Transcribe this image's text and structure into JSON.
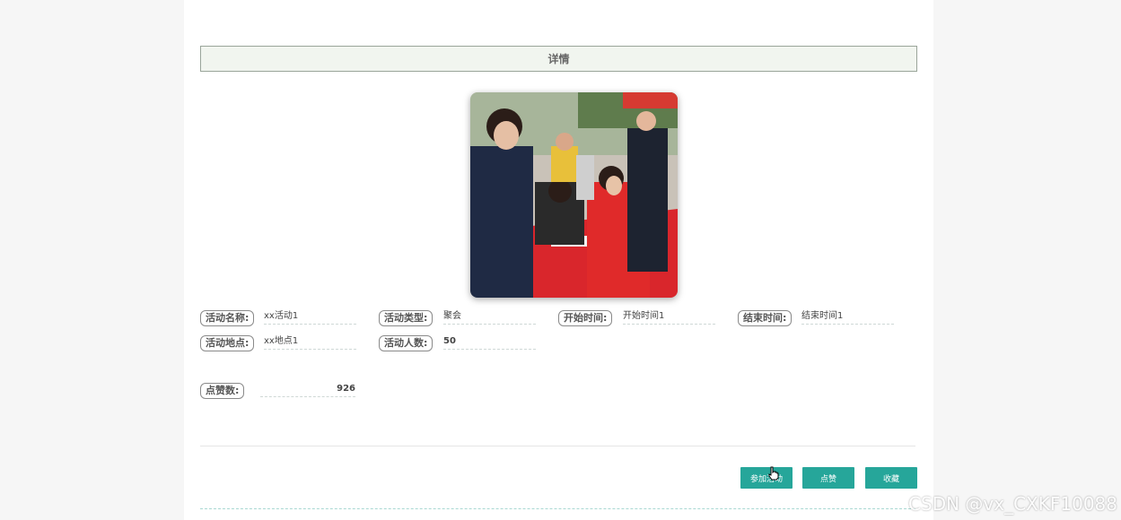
{
  "header": {
    "title": "详情"
  },
  "photo": {
    "alt": "活动图片"
  },
  "fields": [
    {
      "label": "活动名称:",
      "value": "xx活动1"
    },
    {
      "label": "活动类型:",
      "value": "聚会"
    },
    {
      "label": "开始时间:",
      "value": "开始时间1"
    },
    {
      "label": "结束时间:",
      "value": "结束时间1"
    },
    {
      "label": "活动地点:",
      "value": "xx地点1"
    },
    {
      "label": "活动人数:",
      "value": "50"
    }
  ],
  "likes": {
    "label": "点赞数:",
    "value": "926"
  },
  "actions": {
    "join_label": "参加活动",
    "like_label": "点赞",
    "favorite_label": "收藏"
  },
  "watermark": "CSDN @vx_CXKF10088",
  "colors": {
    "accent": "#26a69a",
    "header_bg": "#f1f5ef"
  }
}
